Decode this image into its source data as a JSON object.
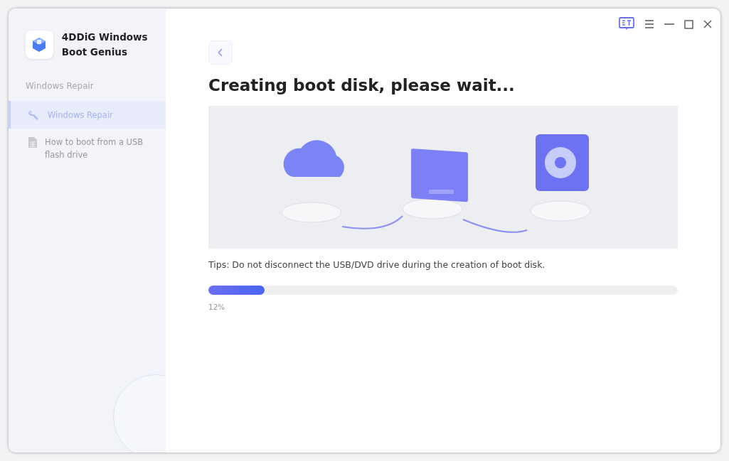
{
  "app": {
    "name": "4DDiG Windows Boot Genius"
  },
  "sidebar": {
    "section": "Windows Repair",
    "items": [
      {
        "label": "Windows Repair",
        "kind": "wrench",
        "selected": true
      },
      {
        "label": "How to boot from a USB flash drive",
        "kind": "document",
        "selected": false
      }
    ]
  },
  "main": {
    "title": "Creating boot disk, please wait...",
    "tips": "Tips: Do not disconnect the USB/DVD drive during the creation of boot disk.",
    "progress": {
      "level": 0.12,
      "reading": "12%"
    }
  }
}
